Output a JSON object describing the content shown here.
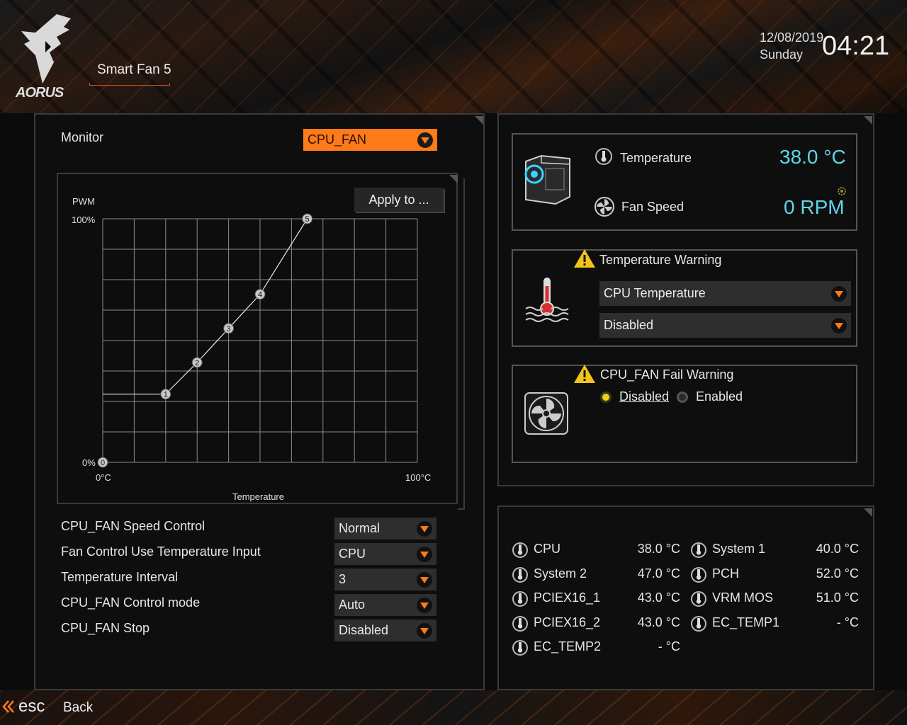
{
  "header": {
    "logo_text": "AORUS",
    "menu_title": "Smart Fan 5",
    "date": "12/08/2019",
    "day": "Sunday",
    "time": "04:21"
  },
  "monitor": {
    "label": "Monitor",
    "selected": "CPU_FAN"
  },
  "chart_data": {
    "type": "line",
    "ylabel": "PWM",
    "xlabel": "Temperature",
    "y_ticks": [
      "100%",
      "0%"
    ],
    "x_ticks": [
      "0°C",
      "100°C"
    ],
    "xlim": [
      0,
      100
    ],
    "ylim": [
      0,
      100
    ],
    "grid": true,
    "point_labels": [
      "0",
      "1",
      "2",
      "3",
      "4",
      "5"
    ],
    "points": [
      {
        "label": "0",
        "x": 0,
        "y": 0
      },
      {
        "label": "1",
        "x": 20,
        "y": 28
      },
      {
        "label": "2",
        "x": 30,
        "y": 41
      },
      {
        "label": "3",
        "x": 40,
        "y": 55
      },
      {
        "label": "4",
        "x": 50,
        "y": 69
      },
      {
        "label": "5",
        "x": 65,
        "y": 100
      }
    ]
  },
  "apply_button": "Apply to ...",
  "settings": [
    {
      "label": "CPU_FAN Speed Control",
      "value": "Normal"
    },
    {
      "label": "Fan Control Use Temperature Input",
      "value": "CPU"
    },
    {
      "label": "Temperature Interval",
      "value": "3"
    },
    {
      "label": "CPU_FAN Control mode",
      "value": "Auto"
    },
    {
      "label": "CPU_FAN Stop",
      "value": "Disabled"
    }
  ],
  "status": {
    "temperature_label": "Temperature",
    "temperature_value": "38.0 °C",
    "fan_speed_label": "Fan Speed",
    "fan_speed_value": "0 RPM"
  },
  "temp_warning": {
    "title": "Temperature Warning",
    "source": "CPU Temperature",
    "value": "Disabled"
  },
  "fan_fail_warning": {
    "title": "CPU_FAN Fail Warning",
    "options": [
      "Disabled",
      "Enabled"
    ],
    "selected": "Disabled"
  },
  "temps": {
    "left": [
      {
        "name": "CPU",
        "value": "38.0 °C"
      },
      {
        "name": "System 2",
        "value": "47.0 °C"
      },
      {
        "name": "PCIEX16_1",
        "value": "43.0 °C"
      },
      {
        "name": "PCIEX16_2",
        "value": "43.0 °C"
      },
      {
        "name": "EC_TEMP2",
        "value": "- °C"
      }
    ],
    "right": [
      {
        "name": "System 1",
        "value": "40.0 °C"
      },
      {
        "name": "PCH",
        "value": "52.0 °C"
      },
      {
        "name": "VRM MOS",
        "value": "51.0 °C"
      },
      {
        "name": "EC_TEMP1",
        "value": "- °C"
      }
    ]
  },
  "footer": {
    "esc_label": "esc",
    "back_label": "Back"
  },
  "colors": {
    "accent": "#ff7a18",
    "value_cyan": "#5fd8e8",
    "warning_yellow": "#f0c419"
  }
}
